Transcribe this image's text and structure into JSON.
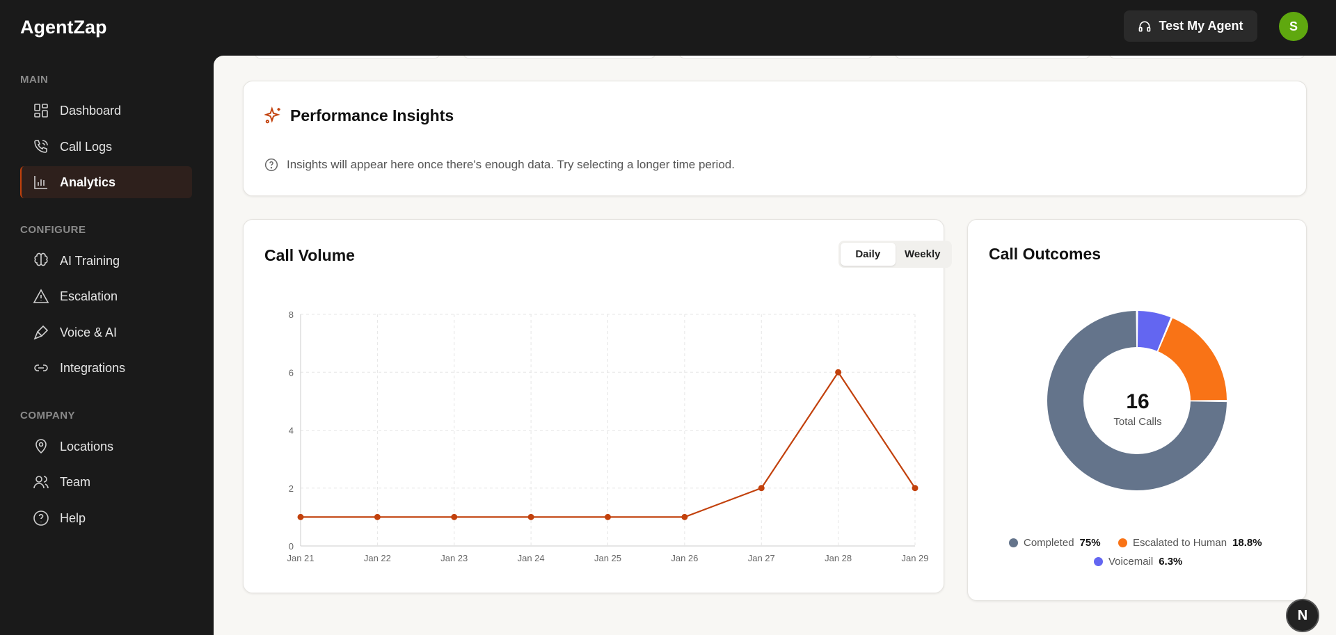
{
  "app": {
    "title": "AgentZap",
    "test_button": "Test My Agent",
    "avatar_initial": "S"
  },
  "sidebar": {
    "sections": [
      {
        "label": "MAIN",
        "items": [
          {
            "label": "Dashboard",
            "icon": "dashboard-icon"
          },
          {
            "label": "Call Logs",
            "icon": "phone-call-icon"
          },
          {
            "label": "Analytics",
            "icon": "bar-chart-icon",
            "active": true
          }
        ]
      },
      {
        "label": "CONFIGURE",
        "items": [
          {
            "label": "AI Training",
            "icon": "brain-icon"
          },
          {
            "label": "Escalation",
            "icon": "alert-triangle-icon"
          },
          {
            "label": "Voice & AI",
            "icon": "microphone-icon"
          },
          {
            "label": "Integrations",
            "icon": "link-icon"
          }
        ]
      },
      {
        "label": "COMPANY",
        "items": [
          {
            "label": "Locations",
            "icon": "map-pin-icon"
          },
          {
            "label": "Team",
            "icon": "users-icon"
          },
          {
            "label": "Help",
            "icon": "help-circle-icon"
          }
        ]
      }
    ]
  },
  "insights": {
    "title": "Performance Insights",
    "message": "Insights will appear here once there's enough data. Try selecting a longer time period."
  },
  "call_volume": {
    "title": "Call Volume",
    "toggle": [
      "Daily",
      "Weekly"
    ],
    "selected": "Daily"
  },
  "call_outcomes": {
    "title": "Call Outcomes",
    "center_value": "16",
    "center_label": "Total Calls"
  },
  "colors": {
    "accent": "#c2410c",
    "completed": "#64748b",
    "escalated": "#f97316",
    "voicemail": "#6366f1"
  },
  "chart_data": [
    {
      "type": "line",
      "categories": [
        "Jan 21",
        "Jan 22",
        "Jan 23",
        "Jan 24",
        "Jan 25",
        "Jan 26",
        "Jan 27",
        "Jan 28",
        "Jan 29"
      ],
      "values": [
        1,
        1,
        1,
        1,
        1,
        1,
        2,
        6,
        2
      ],
      "ylim": [
        0,
        8
      ],
      "yticks": [
        "0",
        "2",
        "4",
        "6",
        "8"
      ],
      "grid": true,
      "color": "#c2410c"
    },
    {
      "type": "pie",
      "donut": true,
      "slices": [
        {
          "name": "Voicemail",
          "value": 6.3,
          "label": "6.3%",
          "color": "#6366f1"
        },
        {
          "name": "Escalated to Human",
          "value": 18.8,
          "label": "18.8%",
          "color": "#f97316"
        },
        {
          "name": "Completed",
          "value": 75,
          "label": "75%",
          "color": "#64748b"
        }
      ],
      "legend": "bottom"
    }
  ]
}
